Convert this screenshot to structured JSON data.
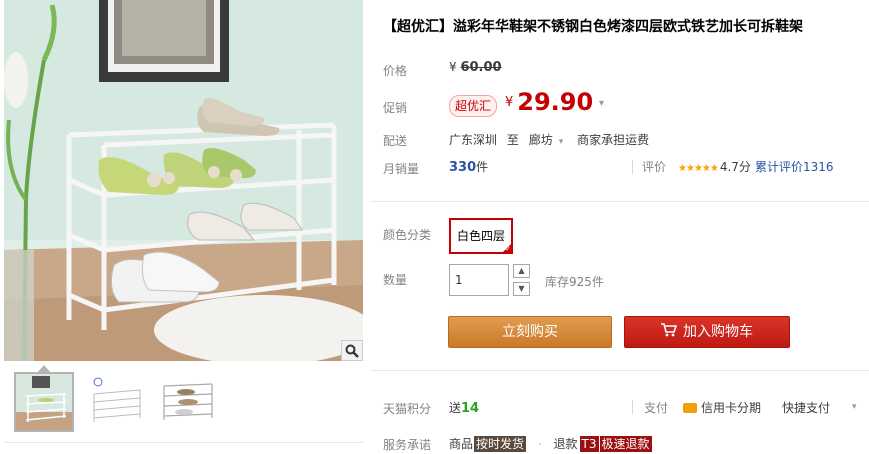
{
  "product": {
    "title": "【超优汇】溢彩年华鞋架不锈钢白色烤漆四层欧式铁艺加长可拆鞋架"
  },
  "price": {
    "label": "价格",
    "currency": "¥",
    "original": "60.00"
  },
  "promo": {
    "label": "促销",
    "badge": "超优汇",
    "currency": "¥",
    "price": "29.90",
    "caret": "▾"
  },
  "shipping": {
    "label": "配送",
    "from": "广东深圳",
    "to_word": "至",
    "to": "廊坊",
    "caret": "▾",
    "fee": "商家承担运费"
  },
  "sales": {
    "label": "月销量",
    "count": "330",
    "unit": "件"
  },
  "rating": {
    "label": "评价",
    "stars": "★★★★★",
    "score": "4.7分",
    "total": "累计评价1316"
  },
  "sku": {
    "label": "颜色分类",
    "selected": "白色四层",
    "check": "✓"
  },
  "quantity": {
    "label": "数量",
    "value": "1",
    "up": "▲",
    "down": "▼",
    "stock": "库存925件"
  },
  "buttons": {
    "buy_now": "立刻购买",
    "add_to_cart": "加入购物车"
  },
  "points": {
    "label": "天猫积分",
    "prefix": "送",
    "value": "14"
  },
  "payment": {
    "label": "支付",
    "credit_card": "信用卡分期",
    "quick": "快捷支付",
    "caret": "▾"
  },
  "service": {
    "label": "服务承诺",
    "item1_prefix": "商品",
    "item1_tag": "按时发货",
    "dot": "·",
    "item2_prefix": "退款",
    "item2_badge": "T3",
    "item2_tag": "极速退款"
  },
  "icons": {
    "zoom": "magnifier-icon",
    "cart": "shopping-cart-icon",
    "card": "credit-card-icon"
  },
  "colors": {
    "accent_red": "#c40000",
    "buy_orange": "#d98a34",
    "cart_red": "#c9221a",
    "link_blue": "#2953a6",
    "points_green": "#2aa124",
    "star_gold": "#f7a600"
  }
}
